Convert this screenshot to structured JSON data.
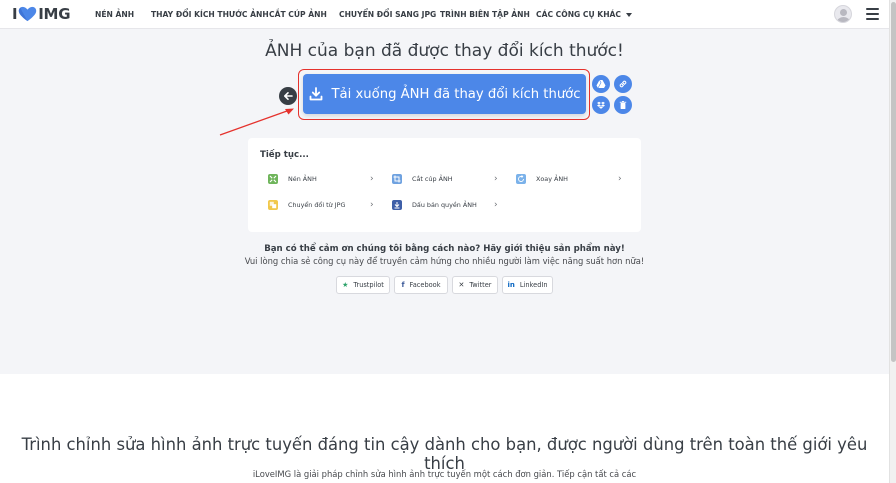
{
  "header": {
    "logo_left": "I",
    "logo_right": "IMG",
    "nav": [
      "NÉN ẢNH",
      "THAY ĐỔI KÍCH THƯỚC ẢNH",
      "CẮT CÚP ẢNH",
      "CHUYỂN ĐỔI SANG JPG",
      "TRÌNH BIÊN TẬP ẢNH",
      "CÁC CÔNG CỤ KHÁC"
    ]
  },
  "main": {
    "title": "ẢNH của bạn đã được thay đổi kích thước!",
    "download_label": "Tải xuống ẢNH đã thay đổi kích thước"
  },
  "continue_card": {
    "title": "Tiếp tục...",
    "tools": [
      "Nén ẢNH",
      "Cắt cúp ẢNH",
      "Xoay ẢNH",
      "Chuyển đổi từ JPG",
      "Dấu bản quyền ẢNH"
    ]
  },
  "share": {
    "question": "Bạn có thể cảm ơn chúng tôi bằng cách nào? Hãy giới thiệu sản phẩm này!",
    "subtitle": "Vui lòng chia sẻ công cụ này để truyền cảm hứng cho nhiều người làm việc năng suất hơn nữa!",
    "buttons": [
      "Trustpilot",
      "Facebook",
      "Twitter",
      "LinkedIn"
    ]
  },
  "lower": {
    "title": "Trình chỉnh sửa hình ảnh trực tuyến đáng tin cậy dành cho bạn, được người dùng trên toàn thế giới yêu thích",
    "text": "iLoveIMG là giải pháp chỉnh sửa hình ảnh trực tuyến một cách đơn giản. Tiếp cận tất cả các"
  },
  "colors": {
    "accent_blue": "#4c87e8",
    "highlight_red": "#e5322d",
    "text_dark": "#383e45",
    "brand_heart": "#4c87e8"
  },
  "icons": [
    "heart-logo-icon",
    "caret-down-icon",
    "user-avatar-icon",
    "hamburger-menu-icon",
    "arrow-left-icon",
    "download-icon",
    "google-drive-icon",
    "link-icon",
    "dropbox-icon",
    "trash-icon",
    "compress-icon",
    "crop-icon",
    "rotate-icon",
    "convert-from-jpg-icon",
    "watermark-icon",
    "chevron-right-icon",
    "trustpilot-star-icon",
    "facebook-icon",
    "x-twitter-icon",
    "linkedin-icon"
  ]
}
